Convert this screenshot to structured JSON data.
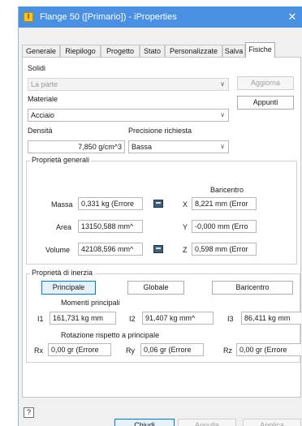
{
  "window": {
    "title": "Flange 50 ([Primario]) - iProperties",
    "close_symbol": "✕",
    "app_icon": "inventor-app-icon",
    "accent_color": "#4a90e2"
  },
  "tabs": [
    "Generale",
    "Riepilogo",
    "Progetto",
    "Stato",
    "Personalizzate",
    "Salva",
    "Fisiche"
  ],
  "active_tab": "Fisiche",
  "solidi": {
    "label": "Solidi",
    "value": "La parte",
    "update_button": "Aggiorna"
  },
  "materiale": {
    "label": "Materiale",
    "value": "Acciaio",
    "clipboard_button": "Appunti"
  },
  "densita": {
    "label": "Densità",
    "value": "7,850 g/cm^3"
  },
  "precisione": {
    "label": "Precisione richiesta",
    "value": "Bassa"
  },
  "proprieta_generali": {
    "title": "Proprietà generali",
    "baricentro_label": "Baricentro",
    "massa_label": "Massa",
    "massa_value": "0,331 kg (Errore",
    "area_label": "Area",
    "area_value": "13150,588 mm^",
    "volume_label": "Volume",
    "volume_value": "42108,596 mm^",
    "x_label": "X",
    "x_value": "8,221 mm (Error",
    "y_label": "Y",
    "y_value": "-0,000 mm (Erro",
    "z_label": "Z",
    "z_value": "0,598 mm (Error"
  },
  "proprieta_inerzia": {
    "title": "Proprietà di inerzia",
    "buttons": [
      "Principale",
      "Globale",
      "Baricentro"
    ],
    "momenti_label": "Momenti principali",
    "i1_label": "I1",
    "i1_value": "161,731 kg mm",
    "i2_label": "I2",
    "i2_value": "91,407 kg mm^",
    "i3_label": "I3",
    "i3_value": "86,411 kg mm",
    "rotazione_label": "Rotazione rispetto a principale",
    "rx_label": "Rx",
    "rx_value": "0,00 gr (Errore",
    "ry_label": "Ry",
    "ry_value": "0,06 gr (Errore",
    "rz_label": "Rz",
    "rz_value": "0,00 gr (Errore"
  },
  "footer": {
    "help_symbol": "?",
    "close_button": "Chiudi",
    "cancel_button": "Annulla",
    "apply_button": "Applica"
  }
}
